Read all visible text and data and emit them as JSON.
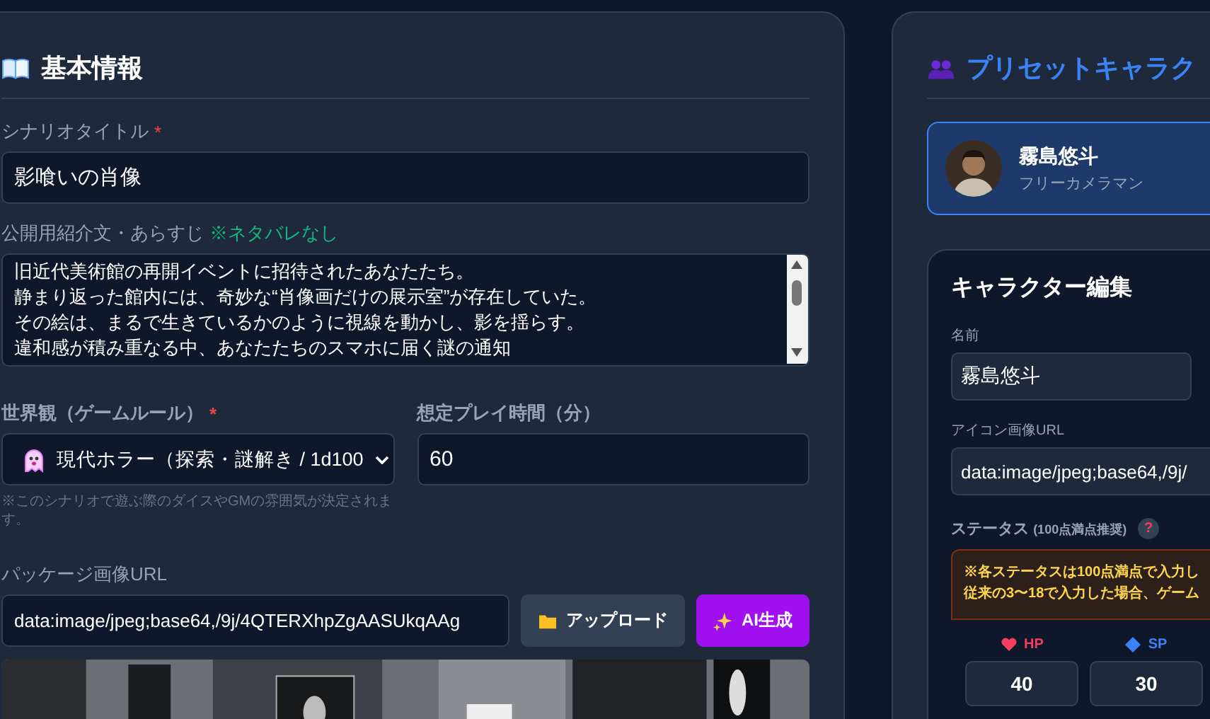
{
  "basic_info": {
    "heading": "基本情報",
    "scenario_title": {
      "label": "シナリオタイトル",
      "required_mark": "*",
      "value": "影喰いの肖像"
    },
    "synopsis": {
      "label": "公開用紹介文・あらすじ",
      "note": "※ネタバレなし",
      "lines": [
        "旧近代美術館の再開イベントに招待されたあなたたち。",
        "静まり返った館内には、奇妙な“肖像画だけの展示室”が存在していた。",
        "その絵は、まるで生きているかのように視線を動かし、影を揺らす。",
        "違和感が積み重なる中、あなたたちのスマホに届く謎の通知"
      ]
    },
    "world": {
      "label": "世界観（ゲームルール）",
      "required_mark": "*",
      "value": "現代ホラー（探索・謎解き / 1d100",
      "hint": "※このシナリオで遊ぶ際のダイスやGMの雰囲気が決定されます。"
    },
    "play_time": {
      "label": "想定プレイ時間（分）",
      "value": "60"
    },
    "package_image": {
      "label": "パッケージ画像URL",
      "value": "data:image/jpeg;base64,/9j/4QTERXhpZgAASUkqAAg",
      "buttons": [
        {
          "kind": "upload",
          "label": "アップロード"
        },
        {
          "kind": "ai",
          "label": "AI生成"
        }
      ]
    }
  },
  "preset_characters": {
    "heading": "プリセットキャラク",
    "characters": [
      {
        "name": "霧島悠斗",
        "role": "フリーカメラマン",
        "selected": true
      }
    ]
  },
  "character_edit": {
    "heading": "キャラクター編集",
    "name": {
      "label": "名前",
      "value": "霧島悠斗"
    },
    "icon_url": {
      "label": "アイコン画像URL",
      "value": "data:image/jpeg;base64,/9j/"
    },
    "status": {
      "label": "ステータス",
      "sub": "(100点満点推奨)",
      "help": "?",
      "warning_lines": [
        "※各ステータスは100点満点で入力し",
        "従来の3〜18で入力した場合、ゲーム"
      ],
      "stats": [
        {
          "kind": "hp",
          "label": "HP",
          "value": "40"
        },
        {
          "kind": "sp",
          "label": "SP",
          "value": "30"
        }
      ]
    }
  }
}
